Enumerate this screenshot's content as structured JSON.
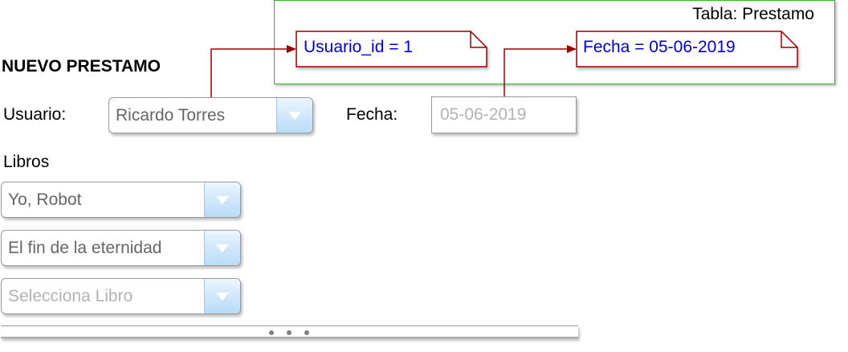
{
  "form": {
    "title": "NUEVO PRESTAMO",
    "usuario_label": "Usuario:",
    "usuario_value": "Ricardo Torres",
    "fecha_label": "Fecha:",
    "fecha_value": "05-06-2019",
    "libros_label": "Libros",
    "libros": [
      {
        "value": "Yo, Robot",
        "placeholder": false
      },
      {
        "value": "El fin de la eternidad",
        "placeholder": false
      },
      {
        "value": "Selecciona Libro",
        "placeholder": true
      }
    ]
  },
  "table": {
    "title": "Tabla: Prestamo",
    "notes": [
      {
        "text": "Usuario_id = 1"
      },
      {
        "text": "Fecha = 05-06-2019"
      }
    ]
  },
  "colors": {
    "note_border": "#990000",
    "note_text": "#0000cc",
    "arrow": "#990000",
    "container_border": "#22bb22",
    "combo_button": "#b9dcf8",
    "arrow_icon": "#ffffff"
  },
  "icons": {
    "dropdown": "chevron-down-icon",
    "scroll_dots": "more-horizontal-icon"
  }
}
